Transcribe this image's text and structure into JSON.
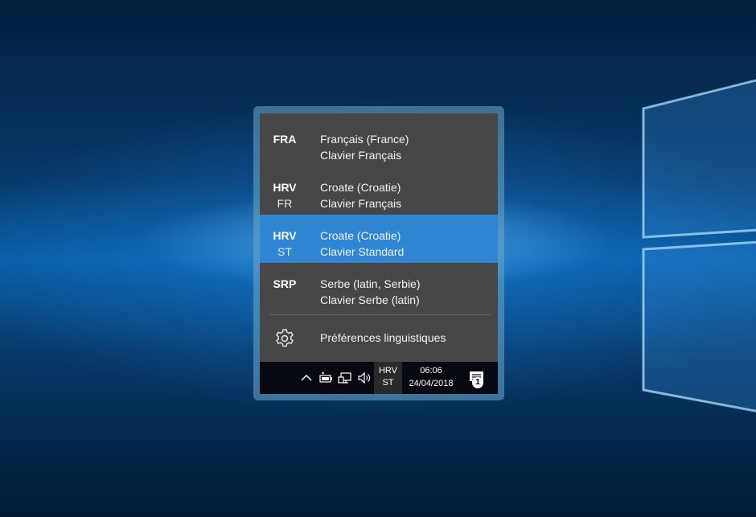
{
  "languages": [
    {
      "code": "FRA",
      "sub": "",
      "name": "Français (France)",
      "keyboard": "Clavier Français",
      "selected": false
    },
    {
      "code": "HRV",
      "sub": "FR",
      "name": "Croate (Croatie)",
      "keyboard": "Clavier Français",
      "selected": false
    },
    {
      "code": "HRV",
      "sub": "ST",
      "name": "Croate (Croatie)",
      "keyboard": "Clavier Standard",
      "selected": true
    },
    {
      "code": "SRP",
      "sub": "",
      "name": "Serbe (latin, Serbie)",
      "keyboard": "Clavier Serbe (latin)",
      "selected": false
    }
  ],
  "preferences": {
    "label": "Préférences linguistiques",
    "icon": "gear-icon"
  },
  "taskbar": {
    "tray_icons": [
      "chevron-up-icon",
      "battery-icon",
      "network-icon",
      "volume-icon"
    ],
    "lang_line1": "HRV",
    "lang_line2": "ST",
    "time": "06:06",
    "date": "24/04/2018",
    "notification_icon": "action-center-icon",
    "notification_count": "1"
  },
  "colors": {
    "flyout_bg": "#474747",
    "selected_bg": "#2f86d2",
    "taskbar_bg": "#060a10"
  }
}
